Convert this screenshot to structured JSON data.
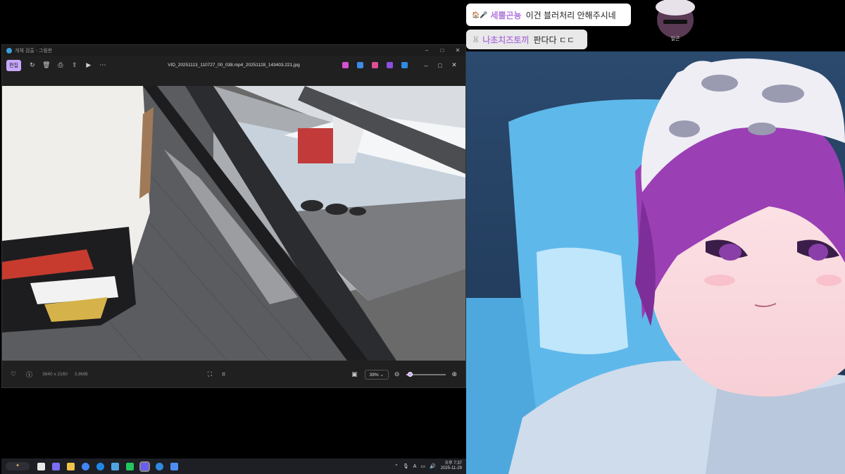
{
  "window": {
    "title": "개체 검출 - 그림판",
    "filename": "VID_20251113_110727_00_038.mp4_20251128_143403.221.jpg",
    "edit_label": "편집",
    "buttons": {
      "minimize": "–",
      "maximize": "□",
      "close": "✕"
    }
  },
  "statusbar": {
    "resolution": "3840 x 2160",
    "filesize": "3.8MB",
    "zoom": "39%",
    "zoom_fraction": 0.08
  },
  "taskbar": {
    "start_label": "✦",
    "tray_time": "오후 7:37",
    "tray_date": "2025-11-29"
  },
  "chat": [
    {
      "emotes": "🏠🎤",
      "nick": "세뿔곤뇽",
      "message": "이건 블러처리 안해주시네"
    },
    {
      "emotes": "🐰",
      "nick": "나초치즈토끼",
      "message": "판다다 ㄷㄷ"
    }
  ],
  "avatar": {
    "name": "일곤"
  },
  "colors": {
    "accent": "#c9a8ff",
    "nick": "#b07bdc"
  }
}
